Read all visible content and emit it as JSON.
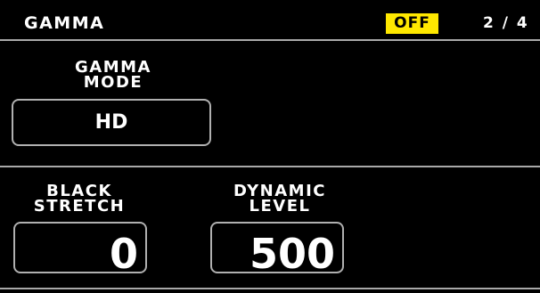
{
  "header": {
    "title": "GAMMA",
    "status": "OFF",
    "page": "2 / 4"
  },
  "params": {
    "gamma_mode": {
      "label_line1": "GAMMA",
      "label_line2": "MODE",
      "value": "HD"
    },
    "black_stretch": {
      "label_line1": "BLACK",
      "label_line2": "STRETCH",
      "value": "0"
    },
    "dynamic_level": {
      "label_line1": "DYNAMIC",
      "label_line2": "LEVEL",
      "value": "500"
    }
  },
  "colors": {
    "background": "#000000",
    "text": "#ffffff",
    "badge_bg": "#ffe800",
    "badge_text": "#000000",
    "divider": "#a9a9a9"
  }
}
